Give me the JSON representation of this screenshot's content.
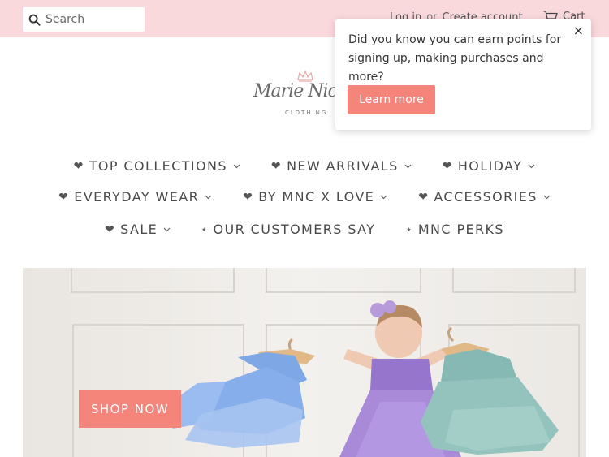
{
  "header": {
    "search_placeholder": "Search",
    "login_label": "Log in",
    "or_label": "or",
    "create_account_label": "Create account",
    "cart_label": "Cart"
  },
  "logo": {
    "script_text": "Marie Nicole",
    "subtitle": "CLOTHING"
  },
  "nav": {
    "row1": [
      {
        "label": "TOP COLLECTIONS",
        "prefix": "heart",
        "has_dropdown": true
      },
      {
        "label": "NEW ARRIVALS",
        "prefix": "heart",
        "has_dropdown": true
      },
      {
        "label": "HOLIDAY",
        "prefix": "heart",
        "has_dropdown": true
      }
    ],
    "row2": [
      {
        "label": "EVERYDAY WEAR",
        "prefix": "heart",
        "has_dropdown": true
      },
      {
        "label": "BY MNC X LOVE",
        "prefix": "heart",
        "has_dropdown": true
      },
      {
        "label": "ACCESSORIES",
        "prefix": "heart",
        "has_dropdown": true
      }
    ],
    "row3": [
      {
        "label": "SALE",
        "prefix": "heart",
        "has_dropdown": true
      },
      {
        "label": "OUR CUSTOMERS SAY",
        "prefix": "star",
        "has_dropdown": false
      },
      {
        "label": "MNC PERKS",
        "prefix": "star",
        "has_dropdown": false
      }
    ]
  },
  "hero": {
    "button_label": "SHOP NOW"
  },
  "popup": {
    "message": "Did you know you can earn points for signing up, making purchases and more?",
    "button_label": "Learn more",
    "close_glyph": "×"
  },
  "colors": {
    "topbar": "#f9d9dc",
    "accent": "#f5847a",
    "dress_blue": "#7ea7e6",
    "dress_purple": "#a98ad9",
    "dress_teal": "#86b9b4"
  }
}
